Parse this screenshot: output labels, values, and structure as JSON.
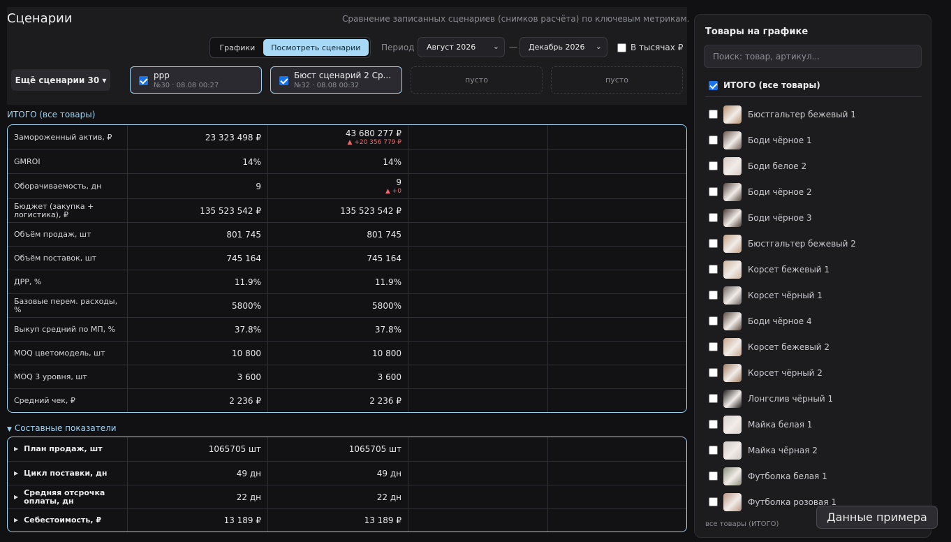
{
  "header": {
    "title": "Сценарии",
    "subtitle": "Сравнение записанных сценариев (снимков расчёта) по ключевым метрикам."
  },
  "toolbar": {
    "tab_charts": "Графики",
    "tab_scenarios": "Посмотреть сценарии",
    "period_label": "Период",
    "period_from": "Август 2026",
    "period_dash": "—",
    "period_to": "Декабрь 2026",
    "thousands_label": "В тысячах ₽",
    "thousands_checked": false,
    "more_scenarios": "Ещё сценарии 30 ▾"
  },
  "scenarios": [
    {
      "name": "ppp",
      "meta": "№30 · 08.08 00:27",
      "checked": true
    },
    {
      "name": "Бюст сценарий 2 Ср...",
      "meta": "№32 · 08.08 00:32",
      "checked": true
    }
  ],
  "empty_slot_label": "пусто",
  "totals_section": {
    "title": "ИТОГО (все товары)",
    "rows": [
      {
        "label": "Замороженный актив, ₽",
        "v1": "23 323 498 ₽",
        "v2": "43 680 277 ₽",
        "d2": "▲ +20 356 779 ₽"
      },
      {
        "label": "GMROI",
        "v1": "14%",
        "v2": "14%"
      },
      {
        "label": "Оборачиваемость, дн",
        "v1": "9",
        "v2": "9",
        "d2": "▲ +0"
      },
      {
        "label": "Бюджет (закупка + логистика), ₽",
        "v1": "135 523 542 ₽",
        "v2": "135 523 542 ₽"
      },
      {
        "label": "Объём продаж, шт",
        "v1": "801 745",
        "v2": "801 745"
      },
      {
        "label": "Объём поставок, шт",
        "v1": "745 164",
        "v2": "745 164"
      },
      {
        "label": "ДРР, %",
        "v1": "11.9%",
        "v2": "11.9%"
      },
      {
        "label": "Базовые перем. расходы, %",
        "v1": "5800%",
        "v2": "5800%"
      },
      {
        "label": "Выкуп средний по МП, %",
        "v1": "37.8%",
        "v2": "37.8%"
      },
      {
        "label": "MOQ цветомодель, шт",
        "v1": "10 800",
        "v2": "10 800"
      },
      {
        "label": "MOQ 3 уровня, шт",
        "v1": "3 600",
        "v2": "3 600"
      },
      {
        "label": "Средний чек, ₽",
        "v1": "2 236 ₽",
        "v2": "2 236 ₽"
      }
    ]
  },
  "composite_section": {
    "title": "Составные показатели",
    "rows": [
      {
        "label": "План продаж, шт",
        "v1": "1065705 шт",
        "v2": "1065705 шт"
      },
      {
        "label": "Цикл поставки, дн",
        "v1": "49 дн",
        "v2": "49 дн"
      },
      {
        "label": "Средняя отсрочка оплаты, дн",
        "v1": "22 дн",
        "v2": "22 дн"
      },
      {
        "label": "Себестоимость, ₽",
        "v1": "13 189 ₽",
        "v2": "13 189 ₽"
      }
    ]
  },
  "panel": {
    "title": "Товары на графике",
    "search_placeholder": "Поиск: товар, артикул...",
    "all_label": "ИТОГО (все товары)",
    "all_checked": true,
    "products": [
      {
        "name": "Бюстгальтер бежевый 1",
        "color": "#b89270"
      },
      {
        "name": "Боди чёрное 1",
        "color": "#6e5a52"
      },
      {
        "name": "Боди белое 2",
        "color": "#d7c9c2"
      },
      {
        "name": "Боди чёрное 2",
        "color": "#54463f"
      },
      {
        "name": "Боди чёрное 3",
        "color": "#4b3b34"
      },
      {
        "name": "Бюстгальтер бежевый 2",
        "color": "#c4a084"
      },
      {
        "name": "Корсет бежевый 1",
        "color": "#cdb39e"
      },
      {
        "name": "Корсет чёрный 1",
        "color": "#6c6462"
      },
      {
        "name": "Боди чёрное 4",
        "color": "#5b4940"
      },
      {
        "name": "Корсет бежевый 2",
        "color": "#c7a58b"
      },
      {
        "name": "Корсет чёрный 2",
        "color": "#a17c62"
      },
      {
        "name": "Лонгслив чёрный 1",
        "color": "#1f1c1c"
      },
      {
        "name": "Майка белая 1",
        "color": "#d9d3cf"
      },
      {
        "name": "Майка чёрная 2",
        "color": "#cfc8c4"
      },
      {
        "name": "Футболка белая 1",
        "color": "#8c8f7c"
      },
      {
        "name": "Футболка розовая 1",
        "color": "#b99484"
      }
    ],
    "footer": "все товары (ИТОГО)"
  },
  "demo_button": "Данные примера"
}
